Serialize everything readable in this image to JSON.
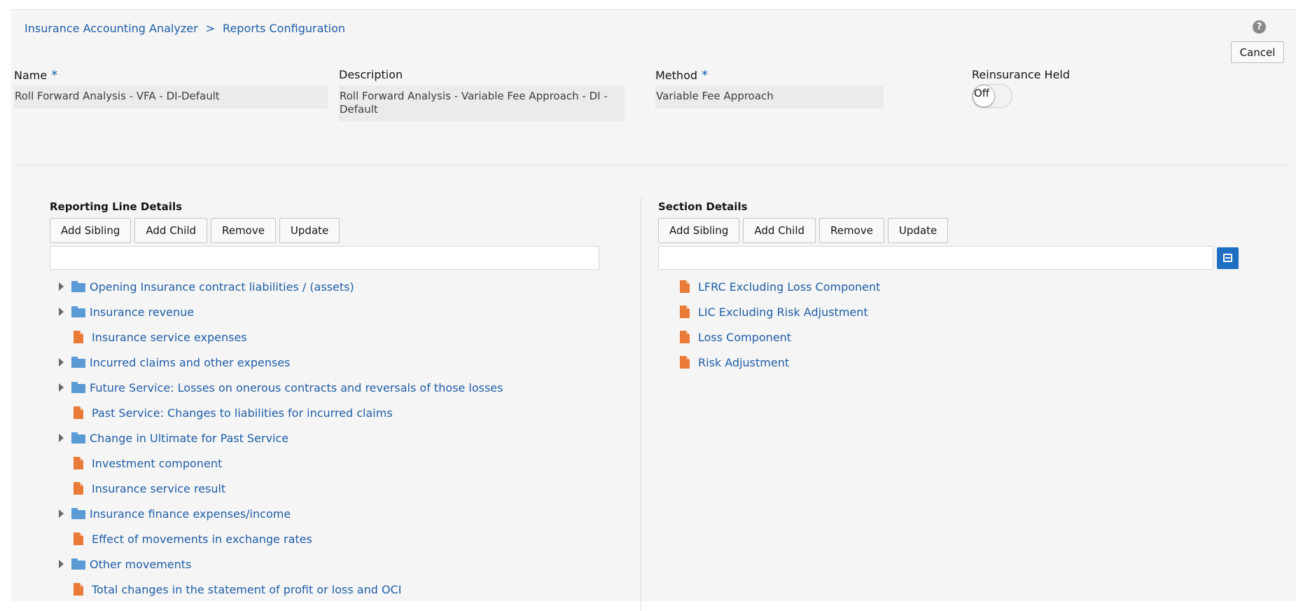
{
  "breadcrumb": {
    "items": [
      "Insurance Accounting Analyzer",
      "Reports Configuration"
    ],
    "separator": ">"
  },
  "header": {
    "help_label": "?",
    "cancel_label": "Cancel"
  },
  "form": {
    "name_label": "Name",
    "name_value": "Roll Forward Analysis - VFA - DI-Default",
    "description_label": "Description",
    "description_value": "Roll Forward Analysis - Variable Fee Approach - DI - Default",
    "method_label": "Method",
    "method_value": "Variable Fee Approach",
    "required_marker": "*",
    "reinsurance_label": "Reinsurance Held",
    "reinsurance_state": "Off"
  },
  "reporting_line": {
    "title": "Reporting Line Details",
    "buttons": [
      "Add Sibling",
      "Add Child",
      "Remove",
      "Update"
    ],
    "filter_value": "",
    "items": [
      {
        "label": "Opening Insurance contract liabilities / (assets)",
        "type": "folder",
        "expandable": true
      },
      {
        "label": "Insurance revenue",
        "type": "folder",
        "expandable": true
      },
      {
        "label": "Insurance service expenses",
        "type": "document",
        "expandable": false
      },
      {
        "label": "Incurred claims and other expenses",
        "type": "folder",
        "expandable": true
      },
      {
        "label": "Future Service: Losses on onerous contracts and reversals of those losses",
        "type": "folder",
        "expandable": true
      },
      {
        "label": "Past Service: Changes to liabilities for incurred claims",
        "type": "document",
        "expandable": false
      },
      {
        "label": "Change in Ultimate for Past Service",
        "type": "folder",
        "expandable": true
      },
      {
        "label": "Investment component",
        "type": "document",
        "expandable": false
      },
      {
        "label": "Insurance service result",
        "type": "document",
        "expandable": false
      },
      {
        "label": "Insurance finance expenses/income",
        "type": "folder",
        "expandable": true
      },
      {
        "label": "Effect of movements in exchange rates",
        "type": "document",
        "expandable": false
      },
      {
        "label": "Other movements",
        "type": "folder",
        "expandable": true
      },
      {
        "label": "Total changes in the statement of profit or loss and OCI",
        "type": "document",
        "expandable": false
      }
    ]
  },
  "section": {
    "title": "Section Details",
    "buttons": [
      "Add Sibling",
      "Add Child",
      "Remove",
      "Update"
    ],
    "filter_value": "",
    "items": [
      {
        "label": "LFRC Excluding Loss Component",
        "type": "document"
      },
      {
        "label": "LIC Excluding Risk Adjustment",
        "type": "document"
      },
      {
        "label": "Loss Component",
        "type": "document"
      },
      {
        "label": "Risk Adjustment",
        "type": "document"
      }
    ]
  },
  "colors": {
    "link": "#1f5ea8",
    "folder": "#5b9bd5",
    "document": "#e97a38",
    "accent_button": "#1e6ec1",
    "page_background": "#f5f5f5"
  },
  "icons": {
    "help": "help-icon",
    "folder": "folder-icon",
    "document": "document-icon",
    "expand": "chevron-right-icon",
    "filter": "filter-icon"
  }
}
